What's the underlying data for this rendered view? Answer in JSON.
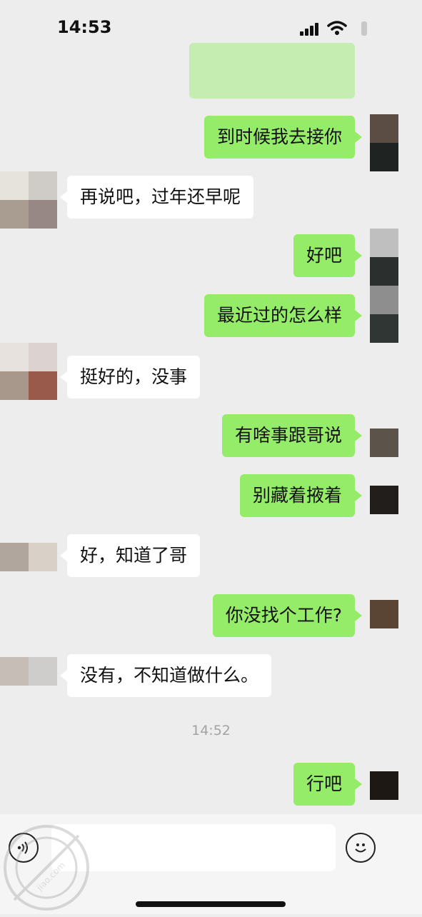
{
  "status_bar": {
    "time": "14:53"
  },
  "messages": [
    {
      "side": "me",
      "text": "到时候我去接你"
    },
    {
      "side": "them",
      "text": "再说吧，过年还早呢"
    },
    {
      "side": "me",
      "text": "好吧"
    },
    {
      "side": "me",
      "text": "最近过的怎么样"
    },
    {
      "side": "them",
      "text": "挺好的，没事"
    },
    {
      "side": "me",
      "text": "有啥事跟哥说"
    },
    {
      "side": "me",
      "text": "别藏着掖着"
    },
    {
      "side": "them",
      "text": "好，知道了哥"
    },
    {
      "side": "me",
      "text": "你没找个工作?"
    },
    {
      "side": "them",
      "text": "没有，不知道做什么。"
    },
    {
      "side": "me",
      "text": "行吧"
    }
  ],
  "timestamp": "14:52",
  "input": {
    "placeholder": ""
  },
  "watermark": {
    "text": "jiao.com"
  },
  "colors": {
    "outgoing_bubble": "#95ec69",
    "incoming_bubble": "#ffffff",
    "background": "#ededed"
  }
}
